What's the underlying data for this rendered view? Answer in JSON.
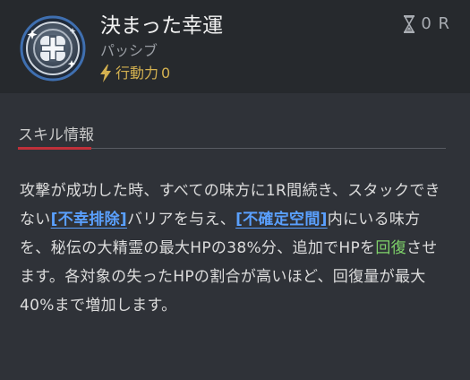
{
  "skill": {
    "name": "決まった幸運",
    "type": "パッシブ",
    "action_label": "行動力",
    "action_value": "0",
    "cooldown": "0 R"
  },
  "section": {
    "title": "スキル情報"
  },
  "description": {
    "p1": "攻撃が成功した時、すべての味方に1R間続き、スタックできない",
    "kw1": "[不幸排除]",
    "p2": "バリアを与え、",
    "kw2": "[不確定空間]",
    "p3": "内にいる味方を、秘伝の大精霊の最大HPの38%分、追加でHPを",
    "heal": "回復",
    "p4": "させます。各対象の失ったHPの割合が高いほど、回復量が最大40%まで増加します。"
  },
  "colors": {
    "keyword": "#5aa0ff",
    "heal": "#7fd36a",
    "action": "#d4b150",
    "accent": "#c0303a"
  },
  "icons": {
    "skill": "clover-cross-emblem-icon",
    "action": "lightning-bolt-icon",
    "cooldown": "hourglass-icon"
  }
}
